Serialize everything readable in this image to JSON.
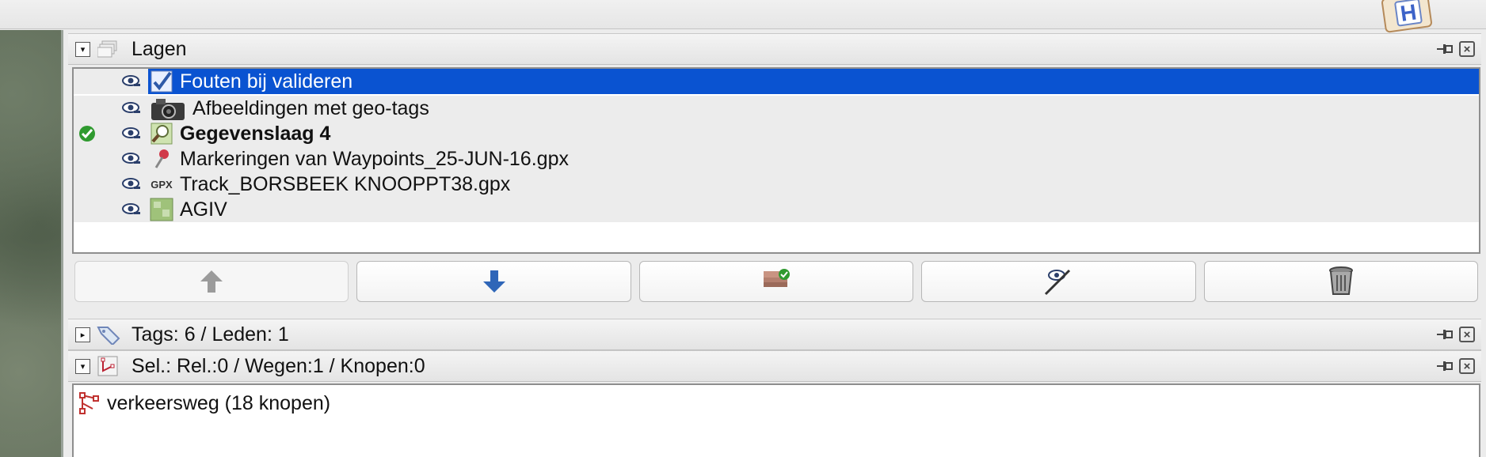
{
  "layers_panel": {
    "title": "Lagen",
    "layers": [
      {
        "name": "Fouten bij valideren",
        "icon": "validation-check-icon",
        "selected": true,
        "active": false,
        "bold": false
      },
      {
        "name": "Afbeeldingen met geo-tags",
        "icon": "camera-icon",
        "selected": false,
        "active": false,
        "bold": false
      },
      {
        "name": "Gegevenslaag 4",
        "icon": "data-layer-icon",
        "selected": false,
        "active": true,
        "bold": true
      },
      {
        "name": "Markeringen van Waypoints_25-JUN-16.gpx",
        "icon": "pushpin-icon",
        "selected": false,
        "active": false,
        "bold": false
      },
      {
        "name": "Track_BORSBEEK KNOOPPT38.gpx",
        "icon": "gpx-icon",
        "selected": false,
        "active": false,
        "bold": false
      },
      {
        "name": "AGIV",
        "icon": "imagery-icon",
        "selected": false,
        "active": false,
        "bold": false
      }
    ],
    "gpx_badge": "GPX",
    "buttons": [
      {
        "name": "move-up",
        "icon": "arrow-up-icon",
        "enabled": false
      },
      {
        "name": "move-down",
        "icon": "arrow-down-icon",
        "enabled": true
      },
      {
        "name": "activate",
        "icon": "activate-layer-icon",
        "enabled": true
      },
      {
        "name": "toggle-visibility",
        "icon": "hide-eye-icon",
        "enabled": true
      },
      {
        "name": "delete",
        "icon": "trash-icon",
        "enabled": true
      }
    ]
  },
  "tags_panel": {
    "title": "Tags: 6 / Leden: 1",
    "collapsed": true
  },
  "selection_panel": {
    "title": "Sel.: Rel.:0 / Wegen:1 / Knopen:0",
    "items": [
      {
        "label": "verkeersweg (18 knopen)",
        "icon": "way-icon"
      }
    ]
  },
  "map_badge": {
    "letter": "H"
  },
  "colors": {
    "selection": "#0a53d1",
    "panel": "#ececec",
    "border": "#8e8e8e"
  }
}
